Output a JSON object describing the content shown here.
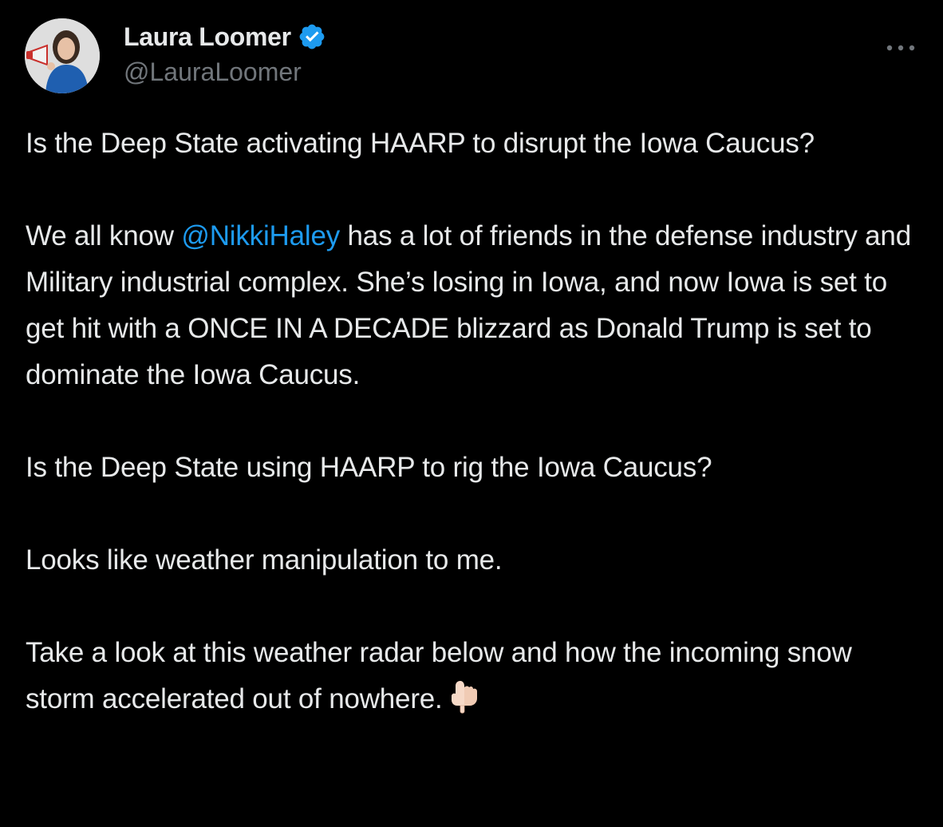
{
  "author": {
    "display_name": "Laura Loomer",
    "handle": "@LauraLoomer",
    "verified_icon": "verified-badge-icon",
    "avatar_icon": "profile-photo-avatar"
  },
  "menu": {
    "more_icon": "more-options-icon"
  },
  "colors": {
    "background": "#000000",
    "text": "#e7e9ea",
    "secondary": "#71767b",
    "link": "#1d9bf0"
  },
  "post": {
    "para1": "Is the Deep State activating HAARP to disrupt the Iowa Caucus?",
    "para2_before": "We all know ",
    "mention": "@NikkiHaley",
    "para2_after": " has a lot of friends in the defense industry and Military industrial complex. She’s losing in Iowa, and now Iowa is set to get hit with a ONCE IN A DECADE blizzard as Donald Trump is set to dominate the Iowa Caucus.",
    "para3": "Is the Deep State using HAARP to rig the Iowa Caucus?",
    "para4": "Looks like weather manipulation to me.",
    "para5": "Take a look at this weather radar below and how the incoming snow storm accelerated out of nowhere.",
    "emoji_icon": "backhand-index-pointing-down-icon"
  }
}
